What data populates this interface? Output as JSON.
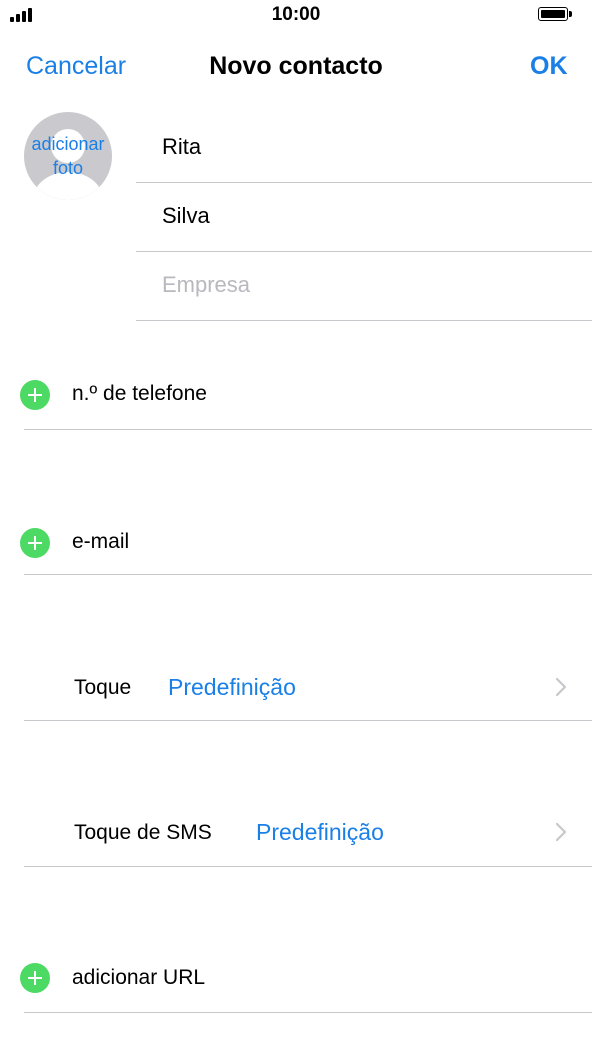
{
  "status_bar": {
    "time": "10:00"
  },
  "nav": {
    "cancel_label": "Cancelar",
    "title": "Novo contacto",
    "ok_label": "OK"
  },
  "avatar": {
    "label": "adicionar foto"
  },
  "name_fields": {
    "first_name": "Rita",
    "last_name": "Silva",
    "company_placeholder": "Empresa"
  },
  "rows": {
    "phone": {
      "label": "n.º de telefone"
    },
    "email": {
      "label": "e-mail"
    },
    "ringtone": {
      "label": "Toque",
      "value": "Predefinição"
    },
    "text_tone": {
      "label": "Toque de SMS",
      "value": "Predefinição"
    },
    "url": {
      "label": "adicionar URL"
    }
  },
  "colors": {
    "accent": "#1a7fe6",
    "add_green": "#4cd964",
    "separator": "#c8c7cc"
  },
  "icons": {
    "signal": "cellular-signal-icon",
    "battery": "battery-icon",
    "avatar": "person-silhouette-icon",
    "add": "plus-circle-icon",
    "disclosure": "chevron-right-icon"
  }
}
